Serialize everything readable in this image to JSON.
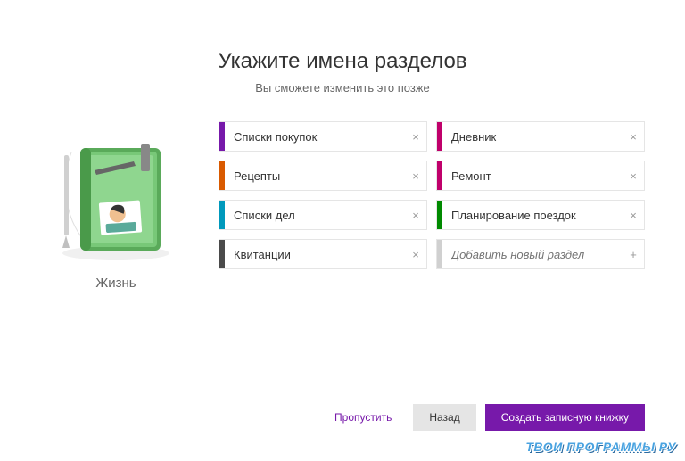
{
  "header": {
    "title": "Укажите имена разделов",
    "subtitle": "Вы сможете изменить это позже"
  },
  "notebook": {
    "label": "Жизнь"
  },
  "sections": [
    {
      "name": "Списки покупок",
      "color": "#7719aa"
    },
    {
      "name": "Дневник",
      "color": "#c0006b"
    },
    {
      "name": "Рецепты",
      "color": "#d95a00"
    },
    {
      "name": "Ремонт",
      "color": "#c0006b"
    },
    {
      "name": "Списки дел",
      "color": "#0099bc"
    },
    {
      "name": "Планирование поездок",
      "color": "#008a00"
    },
    {
      "name": "Квитанции",
      "color": "#4a4a4a"
    }
  ],
  "add_section": {
    "placeholder": "Добавить новый раздел",
    "color": "#d0d0d0"
  },
  "footer": {
    "skip": "Пропустить",
    "back": "Назад",
    "create": "Создать записную книжку"
  },
  "watermark": "ТВОИ ПРОГРАММЫ РУ"
}
